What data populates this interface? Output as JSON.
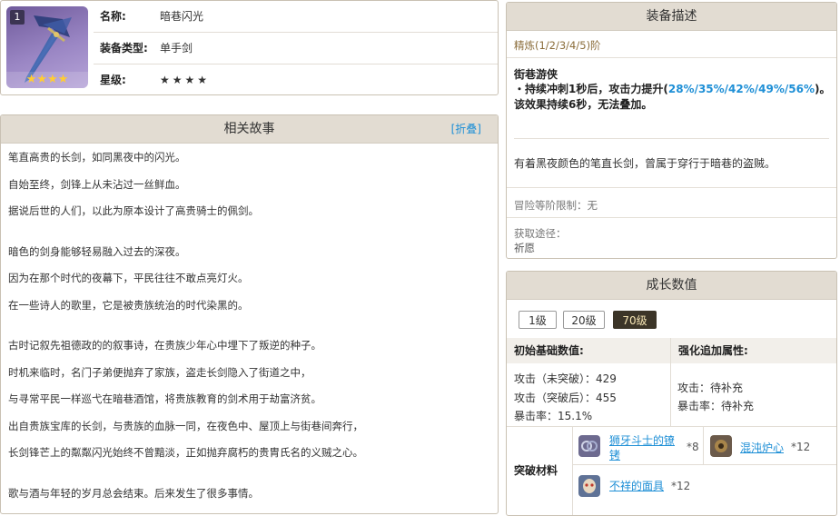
{
  "info": {
    "rank_badge": "1",
    "thumb_stars": "★★★★",
    "name_label": "名称:",
    "name_value": "暗巷闪光",
    "type_label": "装备类型:",
    "type_value": "单手剑",
    "star_label": "星级:",
    "star_value": "★★★★"
  },
  "story": {
    "title": "相关故事",
    "fold": "[折叠]",
    "lines": [
      "笔直高贵的长剑，如同黑夜中的闪光。",
      "自始至终，剑锋上从未沾过一丝鲜血。",
      "据说后世的人们，以此为原本设计了高贵骑士的佩剑。",
      "",
      "暗色的剑身能够轻易融入过去的深夜。",
      "因为在那个时代的夜幕下，平民往往不敢点亮灯火。",
      "在一些诗人的歌里，它是被贵族统治的时代染黑的。",
      "",
      "古时记叙先祖德政的的叙事诗，在贵族少年心中埋下了叛逆的种子。",
      "时机来临时，名门子弟便抛弃了家族，盗走长剑隐入了街道之中，",
      "与寻常平民一样巡弋在暗巷酒馆，将贵族教育的剑术用于劫富济贫。",
      "出自贵族宝库的长剑，与贵族的血脉一同，在夜色中、屋顶上与街巷间奔行，",
      "长剑锋芒上的粼粼闪光始终不曾黯淡，正如抛弃腐朽的贵胄氏名的义贼之心。",
      "",
      "歌与酒与年轻的岁月总会结束。后来发生了很多事情。"
    ]
  },
  "desc": {
    "title": "装备描述",
    "refine": "精炼(1/2/3/4/5)阶",
    "skill_name": "街巷游侠",
    "skill_line1_pre": "・持续冲刺1秒后，攻击力提升(",
    "skill_line1_hl": "28%/35%/42%/49%/56%",
    "skill_line1_post": ")。",
    "skill_line2": "该效果持续6秒，无法叠加。",
    "flavor": "有着黑夜颜色的笔直长剑，曾属于穿行于暗巷的盗贼。",
    "limit": "冒险等阶限制：无",
    "source_label": "获取途径：",
    "source_value": "祈愿"
  },
  "growth": {
    "title": "成长数值",
    "levels": [
      "1级",
      "20级",
      "70级"
    ],
    "active_level": "70级",
    "base_header": "初始基础数值:",
    "bonus_header": "强化追加属性:",
    "base_stats": [
      "攻击（未突破）：429",
      "攻击（突破后）：455",
      "暴击率：15.1%"
    ],
    "bonus_stats": [
      "攻击：待补充",
      "暴击率：待补充"
    ],
    "materials_label": "突破材料",
    "materials": [
      {
        "name_line1": "狮牙斗士的镣",
        "name_line2": "铐",
        "count": "*8",
        "icon": "shackle-icon"
      },
      {
        "name_line1": "混沌炉心",
        "name_line2": "",
        "count": "*12",
        "icon": "chaos-core-icon"
      },
      {
        "name_line1": "不祥的面具",
        "name_line2": "",
        "count": "*12",
        "icon": "mask-icon"
      }
    ]
  },
  "colors": {
    "header_bg": "#e2dcd2",
    "accent_blue": "#1e8fd6",
    "active_level_bg": "#3c3528",
    "star_gold": "#f5a800"
  }
}
